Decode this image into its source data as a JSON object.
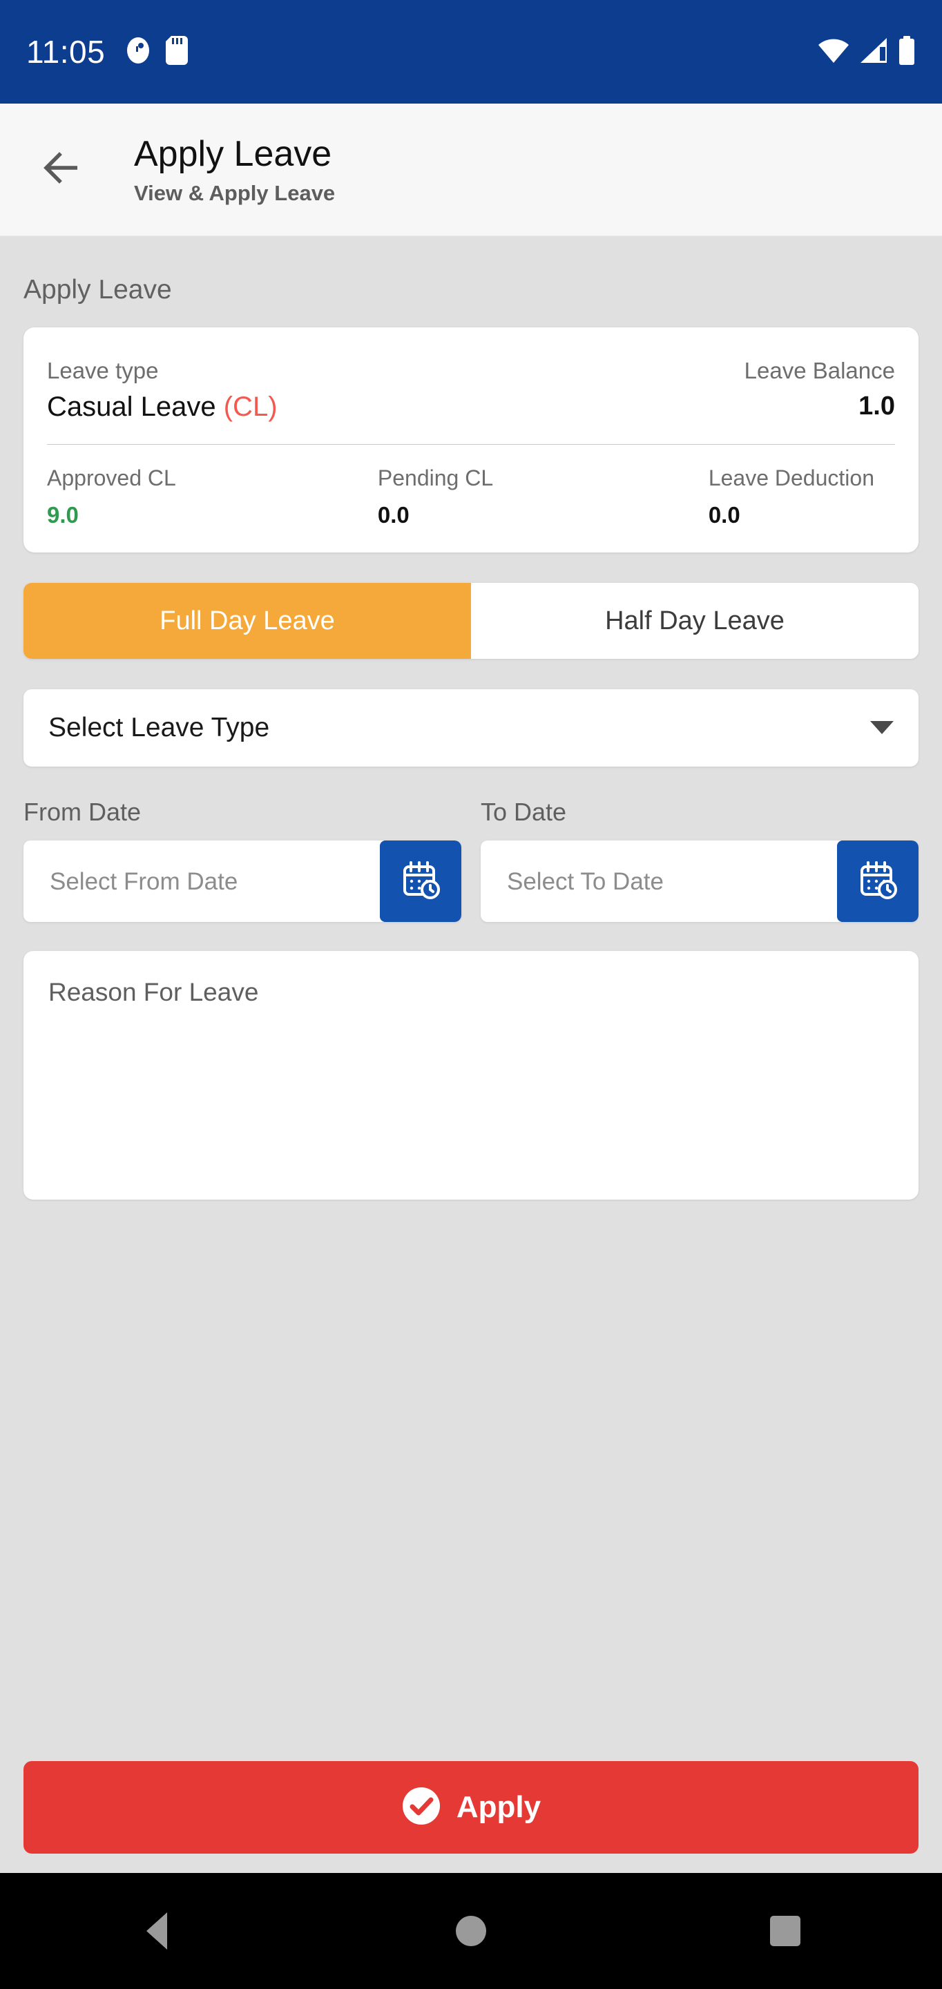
{
  "status_bar": {
    "time": "11:05",
    "left_icons": [
      "clock-icon",
      "sd-card-icon"
    ],
    "right_icons": [
      "wifi-icon",
      "cellular-signal-icon",
      "battery-icon"
    ],
    "background_color": "#0d3d8f"
  },
  "app_bar": {
    "back_icon": "arrow-left-icon",
    "title": "Apply Leave",
    "subtitle": "View & Apply Leave"
  },
  "main": {
    "section_title": "Apply Leave",
    "balance_card": {
      "leave_type_label": "Leave type",
      "leave_type_name": "Casual Leave",
      "leave_type_code": "(CL)",
      "leave_type_code_color": "#f4584f",
      "leave_balance_label": "Leave Balance",
      "leave_balance_value": "1.0",
      "stats": [
        {
          "label": "Approved CL",
          "value": "9.0",
          "color": "#2e9b4e"
        },
        {
          "label": "Pending CL",
          "value": "0.0",
          "color": "#111111"
        },
        {
          "label": "Leave Deduction",
          "value": "0.0",
          "color": "#111111"
        }
      ]
    },
    "day_type_tabs": [
      {
        "label": "Full Day Leave",
        "selected": true,
        "active_color": "#f6a93b"
      },
      {
        "label": "Half Day Leave",
        "selected": false
      }
    ],
    "leave_type_select": {
      "value": "Select Leave Type",
      "caret_icon": "chevron-down-icon"
    },
    "from_date": {
      "label": "From Date",
      "placeholder": "Select From Date",
      "icon": "calendar-clock-icon",
      "icon_button_color": "#1452b0"
    },
    "to_date": {
      "label": "To Date",
      "placeholder": "Select To Date",
      "icon": "calendar-clock-icon",
      "icon_button_color": "#1452b0"
    },
    "reason": {
      "placeholder": "Reason For Leave"
    },
    "apply_button": {
      "label": "Apply",
      "icon": "check-circle-icon",
      "color": "#e53935"
    }
  },
  "nav_bar": {
    "back_label": "back-triangle-icon",
    "home_label": "home-circle-icon",
    "recent_label": "recent-apps-square-icon"
  }
}
